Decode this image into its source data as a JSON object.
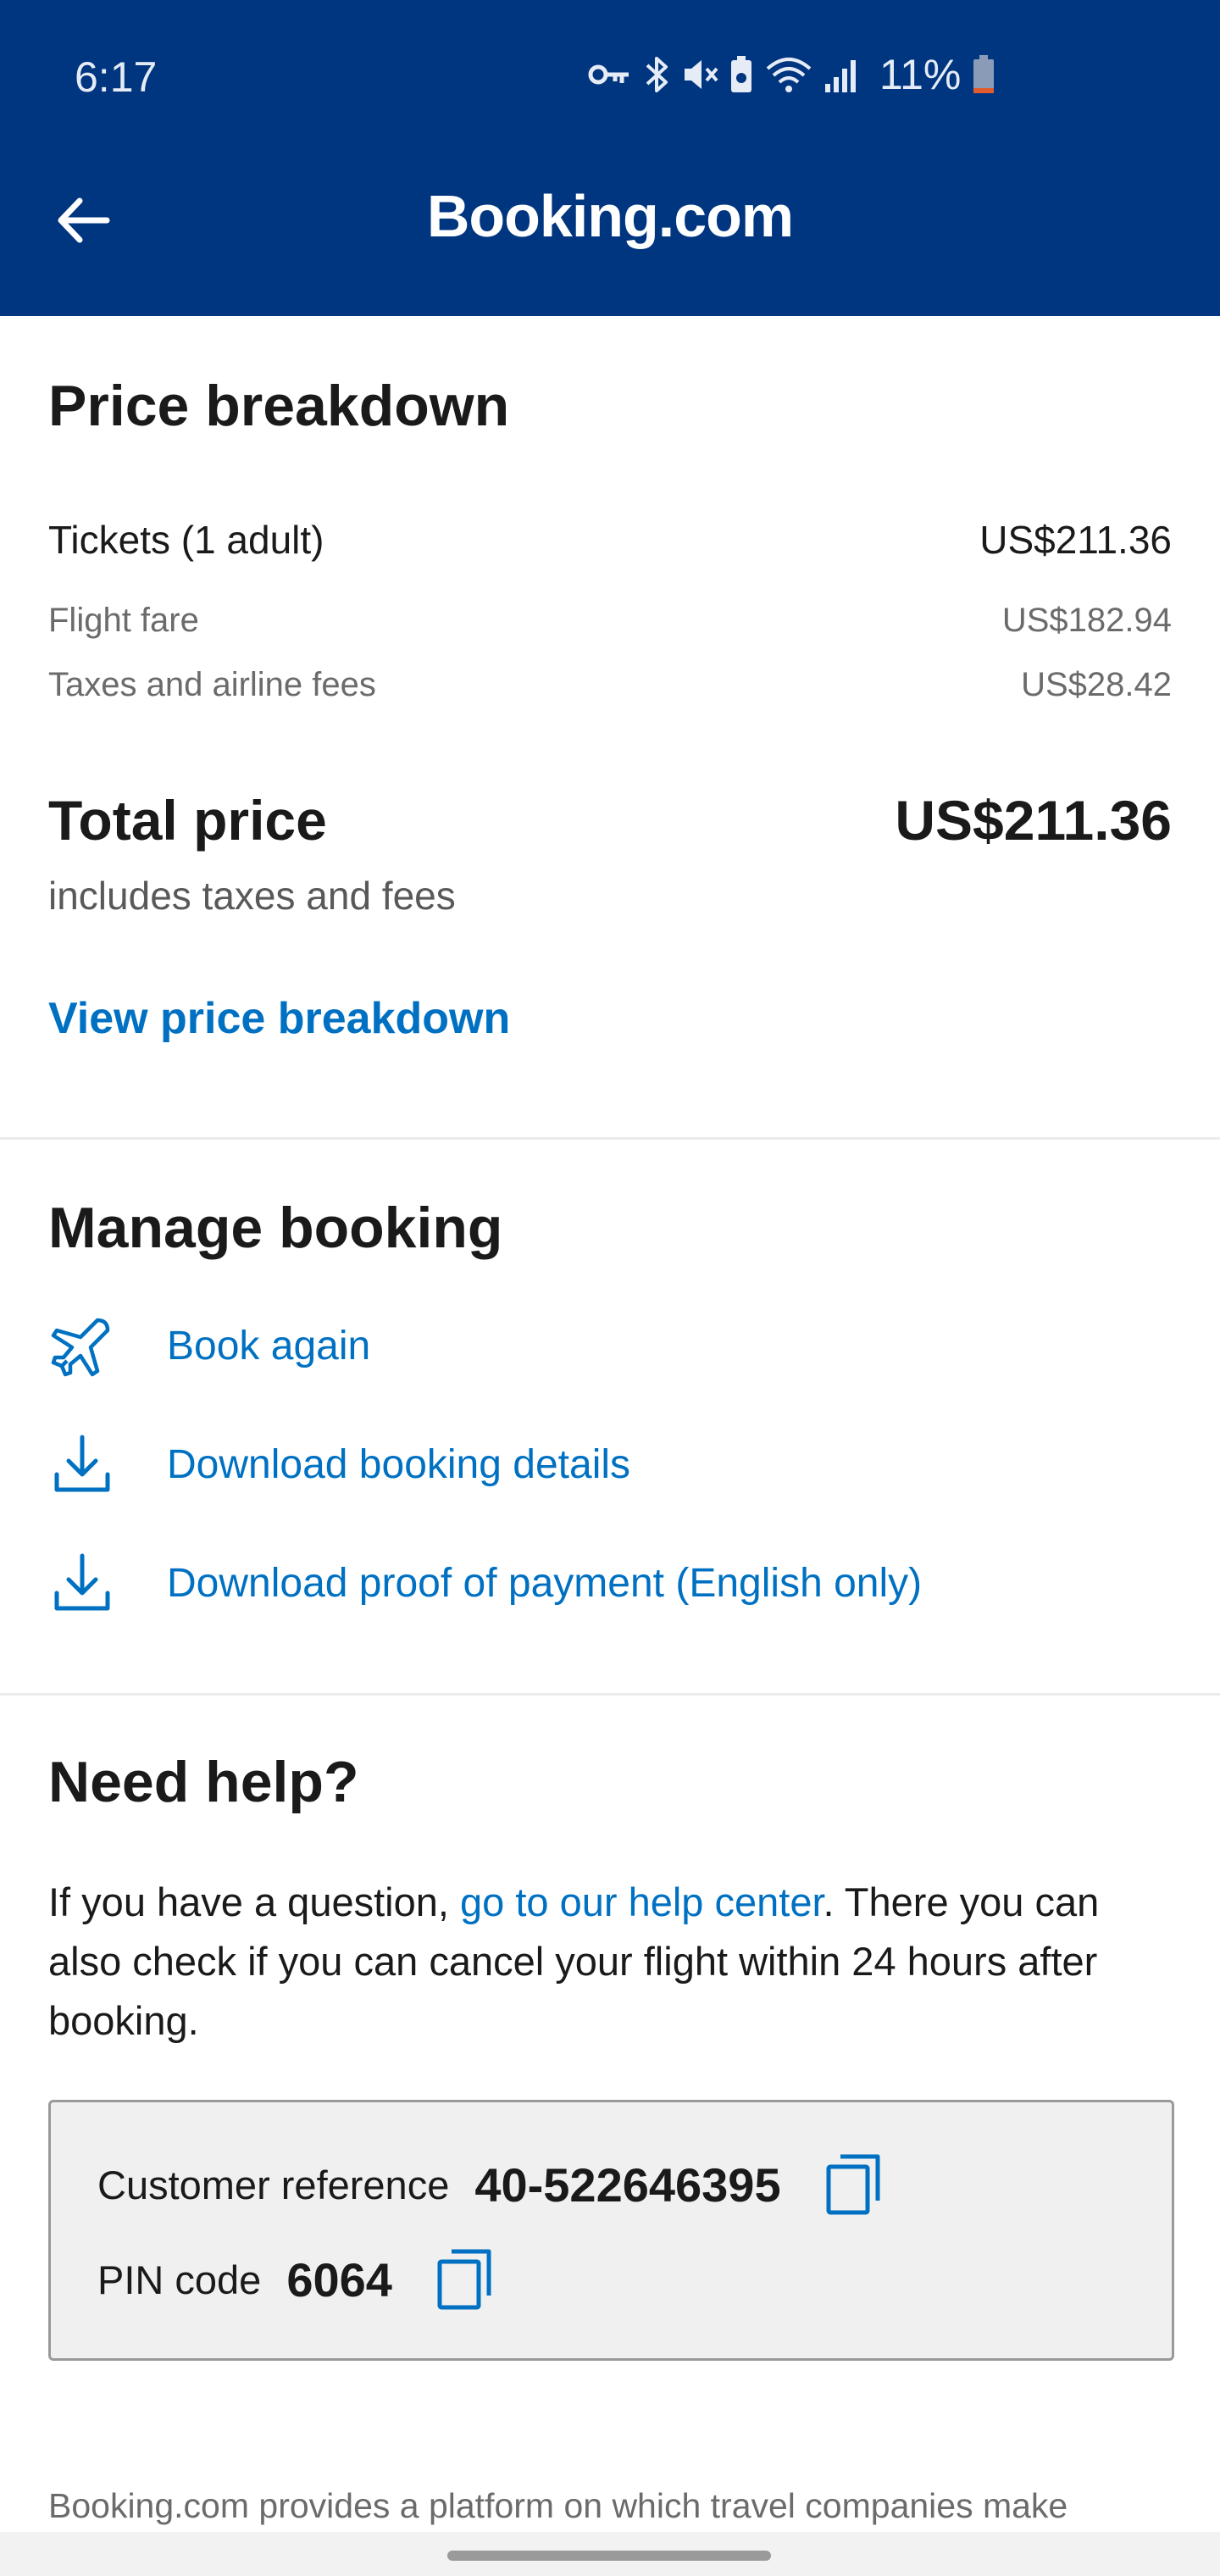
{
  "status_bar": {
    "time": "6:17",
    "battery": "11%",
    "icons": [
      "vpn-key-icon",
      "bluetooth-icon",
      "vibrate-mute-icon",
      "battery-saver-icon",
      "wifi-icon",
      "signal-icon",
      "battery-icon"
    ]
  },
  "app_bar": {
    "brand": "Booking.com",
    "back_icon": "arrow-left-icon"
  },
  "price": {
    "title": "Price breakdown",
    "tickets_label": "Tickets (1 adult)",
    "tickets_value": "US$211.36",
    "fare_label": "Flight fare",
    "fare_value": "US$182.94",
    "taxes_label": "Taxes and airline fees",
    "taxes_value": "US$28.42",
    "total_label": "Total price",
    "total_value": "US$211.36",
    "total_note": "includes taxes and fees",
    "view_link": "View price breakdown"
  },
  "manage": {
    "title": "Manage booking",
    "actions": [
      {
        "label": "Book again",
        "icon": "airplane-icon"
      },
      {
        "label": "Download booking details",
        "icon": "download-icon"
      },
      {
        "label": "Download proof of payment (English only)",
        "icon": "download-icon"
      }
    ]
  },
  "help": {
    "title": "Need help?",
    "text_before": "If you have a question, ",
    "link": "go to our help center",
    "text_after": ". There you can also check if you can cancel your flight within 24 hours after booking.",
    "reference_label": "Customer reference",
    "reference_value": "40-522646395",
    "pin_label": "PIN code",
    "pin_value": "6064"
  },
  "footer": {
    "text": "Booking.com provides a platform on which travel companies make"
  },
  "colors": {
    "header": "#003580",
    "link": "#0071c2",
    "text": "#1a1a1a"
  }
}
